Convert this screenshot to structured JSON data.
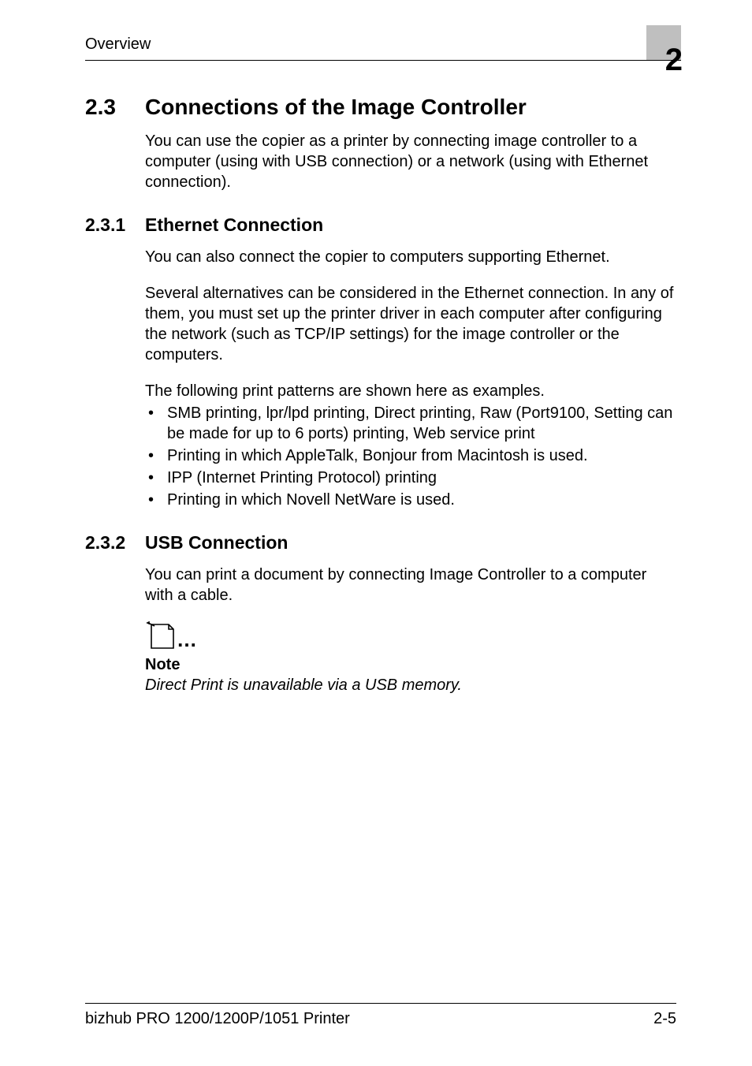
{
  "header": {
    "section": "Overview",
    "chapter_number": "2"
  },
  "section": {
    "number": "2.3",
    "title": "Connections of the Image Controller",
    "intro": "You can use the copier as a printer by connecting image controller to a computer (using with USB connection) or a network (using with Ethernet connection)."
  },
  "sub1": {
    "number": "2.3.1",
    "title": "Ethernet Connection",
    "p1": "You can also connect the copier to computers supporting Ethernet.",
    "p2": "Several alternatives can be considered in the Ethernet connection. In any of them, you must set up the printer driver in each computer after configuring the network (such as TCP/IP settings) for the image controller or the computers.",
    "p3": "The following print patterns are shown here as examples.",
    "bullets": [
      "SMB printing, lpr/lpd printing, Direct printing, Raw (Port9100, Setting can be made for up to 6 ports) printing, Web service print",
      "Printing in which AppleTalk, Bonjour from Macintosh is used.",
      "IPP (Internet Printing Protocol) printing",
      "Printing in which Novell NetWare is used."
    ]
  },
  "sub2": {
    "number": "2.3.2",
    "title": "USB Connection",
    "p1": "You can print a document by connecting Image Controller to a computer with a cable."
  },
  "note": {
    "label": "Note",
    "body": "Direct Print is unavailable via a USB memory."
  },
  "footer": {
    "left": "bizhub PRO 1200/1200P/1051 Printer",
    "right": "2-5"
  }
}
